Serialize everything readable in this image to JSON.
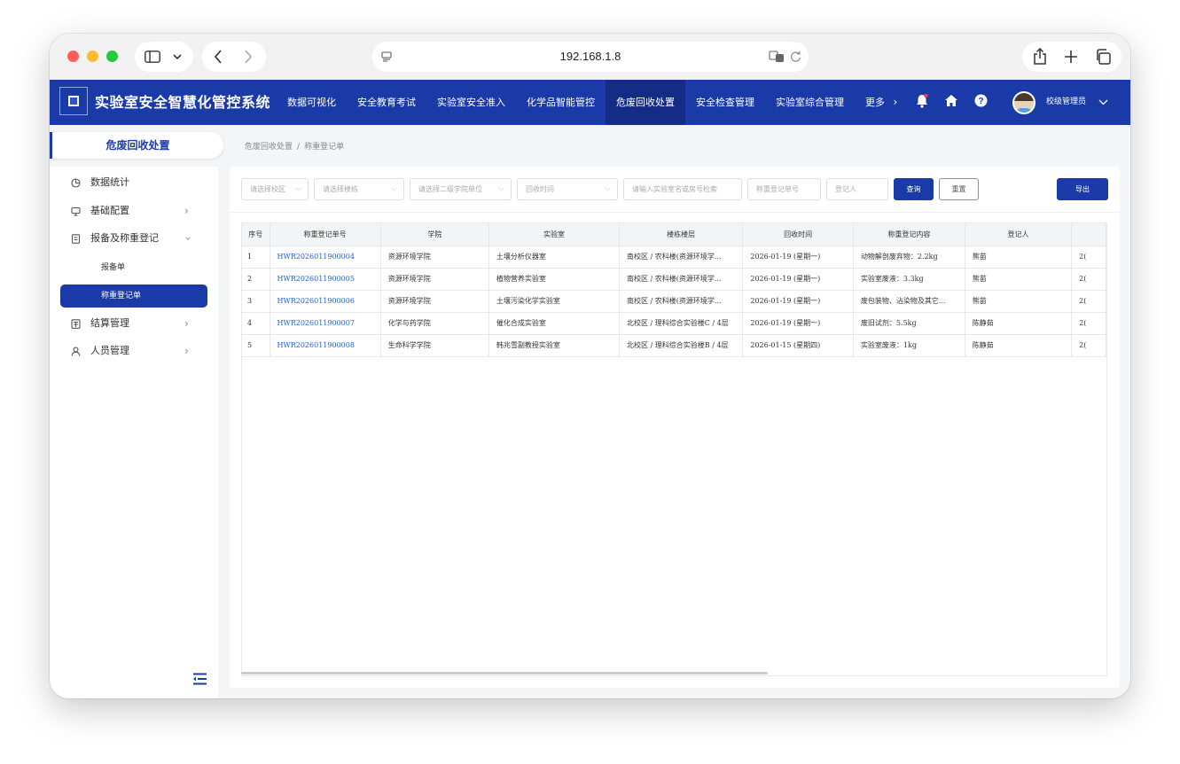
{
  "browser": {
    "address": "192.168.1.8"
  },
  "app": {
    "title": "实验室安全智慧化管控系统",
    "nav": [
      {
        "label": "数据可视化"
      },
      {
        "label": "安全教育考试"
      },
      {
        "label": "实验室安全准入"
      },
      {
        "label": "化学品智能管控"
      },
      {
        "label": "危废回收处置",
        "active": true
      },
      {
        "label": "安全检查管理"
      },
      {
        "label": "实验室综合管理"
      },
      {
        "label": "更多"
      }
    ],
    "user": "校级管理员",
    "accent_color": "#1a3aa8"
  },
  "sidebar": {
    "section_title": "危废回收处置",
    "items": [
      {
        "label": "数据统计",
        "icon": "chart-icon"
      },
      {
        "label": "基础配置",
        "icon": "config-icon"
      },
      {
        "label": "报备及称重登记",
        "icon": "register-icon"
      },
      {
        "label": "结算管理",
        "icon": "settlement-icon"
      },
      {
        "label": "人员管理",
        "icon": "user-icon"
      }
    ],
    "subitems": [
      {
        "label": "报备单"
      },
      {
        "label": "称重登记单",
        "active": true
      }
    ]
  },
  "breadcrumb": {
    "parent": "危废回收处置",
    "current": "称重登记单"
  },
  "filters": {
    "campus": "请选择校区",
    "building": "请选择楼栋",
    "department": "请选择二级学院单位",
    "recycle_time": "回收时间",
    "lab_search": "请输入实验室名或房号检索",
    "order_no": "称重登记单号",
    "registrar": "登记人",
    "query_label": "查询",
    "reset_label": "重置",
    "export_label": "导出"
  },
  "table": {
    "headers": [
      "序号",
      "称重登记单号",
      "学院",
      "实验室",
      "楼栋楼层",
      "回收时间",
      "称重登记内容",
      "登记人"
    ],
    "rows": [
      [
        "1",
        "HWR2026011900004",
        "资源环境学院",
        "土壤分析仪器室",
        "南校区 / 农科楼(资源环境学...",
        "2026-01-19 (星期一)",
        "动物解剖废弃物：2.2kg",
        "熊苗",
        "2("
      ],
      [
        "2",
        "HWR2026011900005",
        "资源环境学院",
        "植物营养实验室",
        "南校区 / 农科楼(资源环境学...",
        "2026-01-19 (星期一)",
        "实验室废液：3.3kg",
        "熊苗",
        "2("
      ],
      [
        "3",
        "HWR2026011900006",
        "资源环境学院",
        "土壤污染化学实验室",
        "南校区 / 农科楼(资源环境学...",
        "2026-01-19 (星期一)",
        "废包装物、沾染物及其它...",
        "熊苗",
        "2("
      ],
      [
        "4",
        "HWR2026011900007",
        "化学与药学院",
        "催化合成实验室",
        "北校区 / 理科综合实验楼C / 4层",
        "2026-01-19 (星期一)",
        "废旧试剂：5.5kg",
        "陈静茹",
        "2("
      ],
      [
        "5",
        "HWR2026011900008",
        "生命科学学院",
        "韩兆雪副教授实验室",
        "北校区 / 理科综合实验楼B / 4层",
        "2026-01-15 (星期四)",
        "实验室废液：1kg",
        "陈静茹",
        "2("
      ]
    ]
  }
}
